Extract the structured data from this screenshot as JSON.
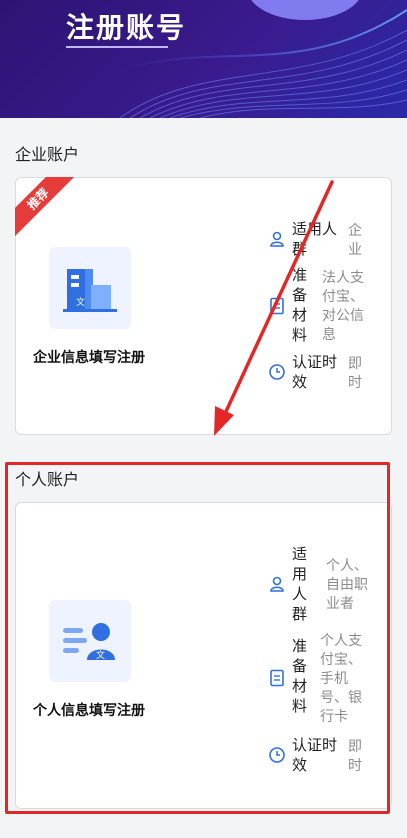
{
  "header": {
    "title": "注册账号"
  },
  "enterprise": {
    "section_label": "企业账户",
    "badge": "推荐",
    "title": "企业信息填写注册",
    "rows": [
      {
        "icon": "user-icon",
        "label": "适用人\n群",
        "value": "企\n业"
      },
      {
        "icon": "document-icon",
        "label": "准\n备\n材\n料",
        "value": "法人支\n付宝、\n对公信\n息"
      },
      {
        "icon": "clock-icon",
        "label": "认证时\n效",
        "value": "即\n时"
      }
    ]
  },
  "personal": {
    "section_label": "个人账户",
    "title": "个人信息填写注册",
    "rows": [
      {
        "icon": "user-icon",
        "label": "适\n用\n人\n群",
        "value": "个人、\n自由职\n业者"
      },
      {
        "icon": "document-icon",
        "label": "准\n备\n材\n料",
        "value": "个人支\n付宝、\n手机\n号、银\n行卡"
      },
      {
        "icon": "clock-icon",
        "label": "认证时\n效",
        "value": "即\n时"
      }
    ]
  },
  "colors": {
    "header": "#2c1473",
    "accent": "#2f6fe0",
    "highlight": "#e32727"
  }
}
